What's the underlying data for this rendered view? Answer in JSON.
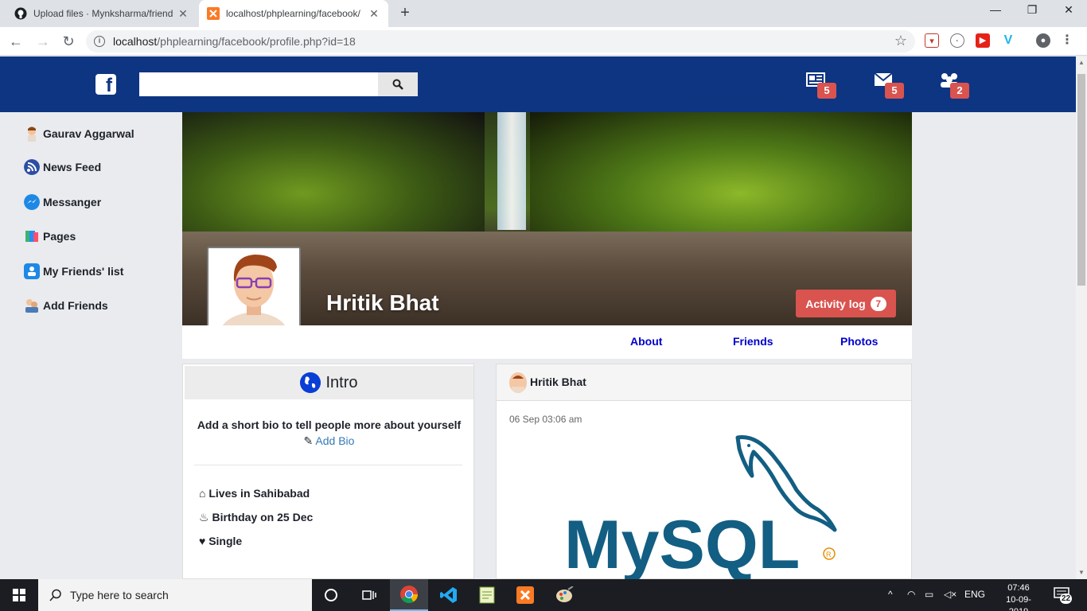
{
  "browser": {
    "tabs": [
      {
        "title": "Upload files · Mynksharma/friend",
        "active": false
      },
      {
        "title": "localhost/phplearning/facebook/",
        "active": true
      }
    ],
    "url_host": "localhost",
    "url_path": "/phplearning/facebook/profile.php?id=18"
  },
  "header": {
    "search_placeholder": "",
    "badges": {
      "news": "5",
      "messages": "5",
      "friend_requests": "2"
    }
  },
  "sidebar": {
    "items": [
      {
        "label": "Gaurav Aggarwal",
        "icon": "user-avatar-icon"
      },
      {
        "label": "News Feed",
        "icon": "rss-icon"
      },
      {
        "label": "Messanger",
        "icon": "messenger-icon"
      },
      {
        "label": "Pages",
        "icon": "pages-icon"
      },
      {
        "label": "My Friends' list",
        "icon": "contacts-icon"
      },
      {
        "label": "Add Friends",
        "icon": "add-friends-icon"
      }
    ]
  },
  "profile": {
    "name": "Hritik Bhat",
    "activity_label": "Activity log",
    "activity_count": "7",
    "nav": {
      "about": "About",
      "friends": "Friends",
      "photos": "Photos"
    }
  },
  "intro": {
    "title": "Intro",
    "bio_prompt": "Add a short bio to tell people more about yourself",
    "add_bio": "Add Bio",
    "lives": "Lives in Sahibabad",
    "birthday": "Birthday on 25 Dec",
    "status": "Single"
  },
  "post": {
    "author": "Hritik Bhat",
    "time": "06 Sep 03:06 am",
    "image_text": "MySQL"
  },
  "taskbar": {
    "search_placeholder": "Type here to search",
    "lang": "ENG",
    "time": "07:46",
    "date": "10-09-2019",
    "notifications": "22"
  },
  "colors": {
    "fb_blue": "#0e3582",
    "badge_red": "#d9534f",
    "link_blue": "#0000cc"
  }
}
